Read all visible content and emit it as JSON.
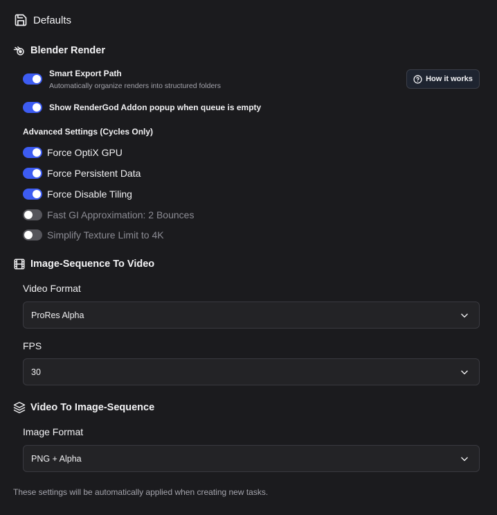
{
  "header": {
    "title": "Defaults",
    "icon": "save-icon"
  },
  "blender_render": {
    "title": "Blender Render",
    "icon": "blender-icon",
    "smart_export": {
      "label": "Smart Export Path",
      "description": "Automatically organize renders into structured folders",
      "enabled": true
    },
    "how_it_works": {
      "label": "How it works",
      "icon": "question-circle-icon"
    },
    "popup": {
      "label": "Show RenderGod Addon popup when queue is empty",
      "enabled": true
    },
    "advanced_title": "Advanced Settings (Cycles Only)",
    "advanced": [
      {
        "label": "Force OptiX GPU",
        "enabled": true
      },
      {
        "label": "Force Persistent Data",
        "enabled": true
      },
      {
        "label": "Force Disable Tiling",
        "enabled": true
      },
      {
        "label": "Fast GI Approximation: 2 Bounces",
        "enabled": false
      },
      {
        "label": "Simplify Texture Limit to 4K",
        "enabled": false
      }
    ]
  },
  "seq_to_video": {
    "title": "Image-Sequence To Video",
    "icon": "film-icon",
    "video_format_label": "Video Format",
    "video_format_value": "ProRes Alpha",
    "fps_label": "FPS",
    "fps_value": "30"
  },
  "video_to_seq": {
    "title": "Video To Image-Sequence",
    "icon": "layers-icon",
    "image_format_label": "Image Format",
    "image_format_value": "PNG + Alpha"
  },
  "footer": {
    "note": "These settings will be automatically applied when creating new tasks."
  },
  "colors": {
    "accent": "#3d5cf2",
    "background": "#1b1b1e",
    "toggle_off": "#55555b"
  }
}
